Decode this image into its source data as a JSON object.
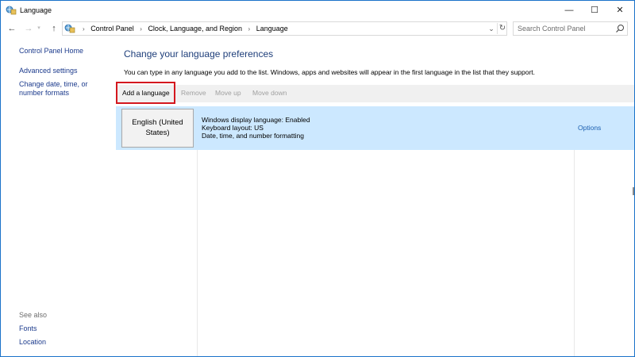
{
  "window": {
    "title": "Language",
    "controls": {
      "minimize": "—",
      "maximize": "☐",
      "close": "✕"
    }
  },
  "nav": {
    "back_icon": "arrow-left-icon",
    "forward_icon": "arrow-right-icon",
    "up_icon": "arrow-up-icon",
    "breadcrumb": [
      "Control Panel",
      "Clock, Language, and Region",
      "Language"
    ],
    "search_placeholder": "Search Control Panel"
  },
  "sidebar": {
    "home": "Control Panel Home",
    "advanced": "Advanced settings",
    "date_time": "Change date, time, or number formats",
    "see_also": "See also",
    "fonts": "Fonts",
    "location": "Location"
  },
  "main": {
    "title": "Change your language preferences",
    "description": "You can type in any language you add to the list. Windows, apps and websites will appear in the first language in the list that they support.",
    "toolbar": {
      "add": "Add a language",
      "remove": "Remove",
      "move_up": "Move up",
      "move_down": "Move down"
    },
    "languages": [
      {
        "name": "English (United States)",
        "details": [
          "Windows display language: Enabled",
          "Keyboard layout: US",
          "Date, time, and number formatting"
        ],
        "options": "Options"
      }
    ]
  },
  "colors": {
    "selection": "#cce8ff",
    "toolbar_bg": "#f0f0f0",
    "highlight_border": "#d4171e",
    "title_blue": "#1e3e7a",
    "link_blue": "#1b5fb0"
  }
}
